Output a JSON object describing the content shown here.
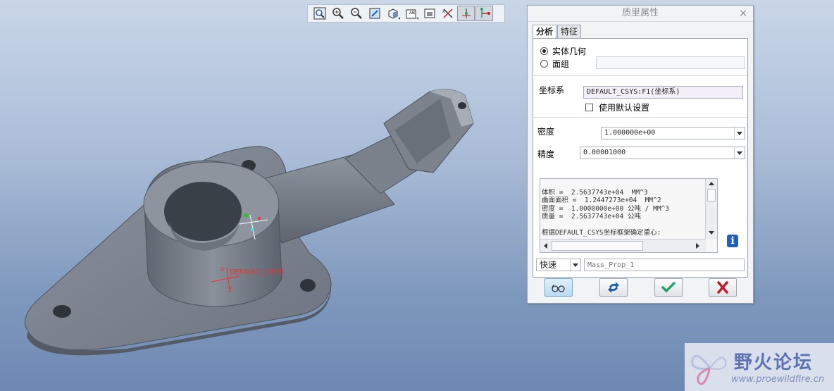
{
  "viewport": {
    "csys_label": "DEFAULT_CSYS",
    "axis_z_label": "Z",
    "axis_x_label": "X",
    "colors": {
      "model": "#7d8490",
      "background_top": "#c9d6e8",
      "background_bottom": "#6e89b2",
      "csys": "#ff2a2a"
    }
  },
  "toolbar": {
    "icons": [
      "zoom-fit-icon",
      "zoom-in-icon",
      "zoom-out-icon",
      "repaint-icon",
      "shading-icon",
      "saved-views-icon",
      "view-manager-icon",
      "datum-display-icon",
      "spin-center-icon",
      "csys-display-icon"
    ]
  },
  "dialog": {
    "title": "质里属性",
    "close": "×",
    "tabs": [
      {
        "label": "分析"
      },
      {
        "label": "特征"
      }
    ],
    "radio_solid": "实体几何",
    "radio_quilt": "面组",
    "quilt_value": "",
    "csys_label": "坐标系",
    "csys_value": "DEFAULT_CSYS:F1(坐标系)",
    "use_default_label": "使用默认设置",
    "density_label": "密度",
    "density_value": "1.000000e+00",
    "accuracy_label": "精度",
    "accuracy_value": "0.00001000",
    "results": [
      "体积 =  2.5637743e+04  MM^3",
      "曲面面积 =  1.2447273e+04  MM^2",
      "密度 =  1.0000000e+00 公吨 / MM^3",
      "质量 =  2.5637743e+04 公吨",
      "",
      "根据DEFAULT_CSYS坐标框架确定重心:"
    ],
    "mode_value": "快速",
    "name_placeholder": "Mass_Prop_1"
  },
  "watermark": {
    "title": "野火论坛",
    "url": "www.proewildfire.cn"
  }
}
